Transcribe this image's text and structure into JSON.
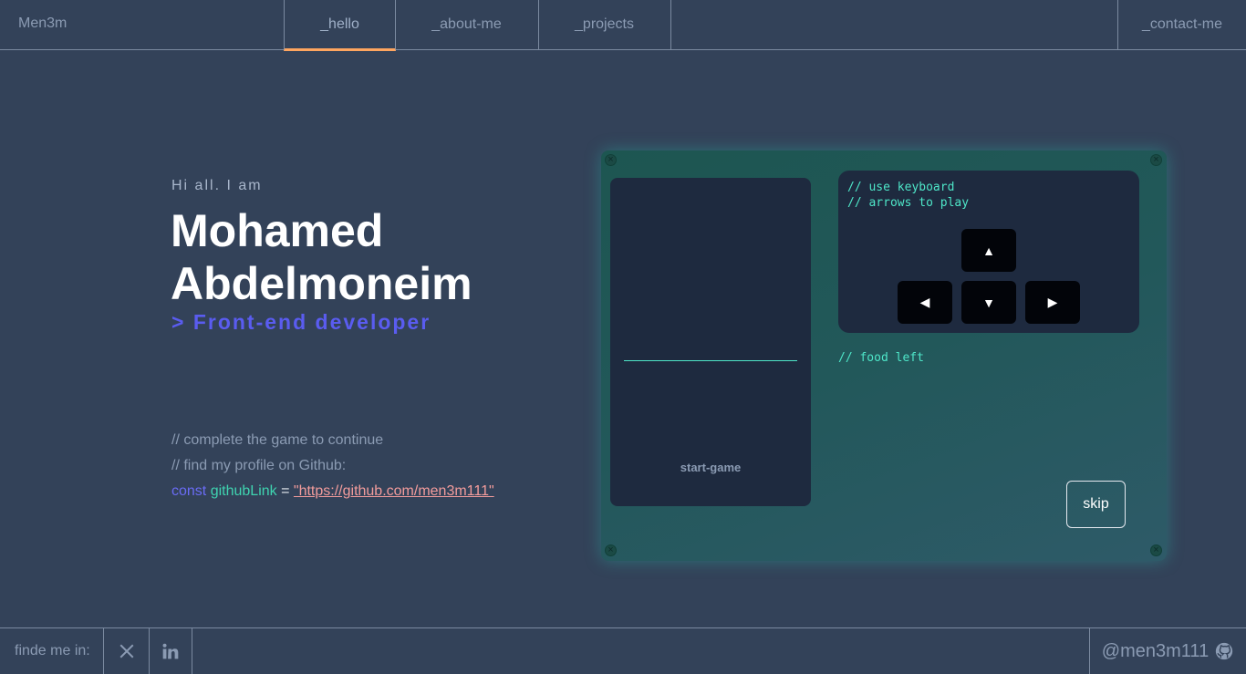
{
  "header": {
    "brand": "Men3m",
    "tabs": [
      {
        "label": "_hello",
        "active": true
      },
      {
        "label": "_about-me"
      },
      {
        "label": "_projects"
      },
      {
        "label": "_contact-me"
      }
    ],
    "accent": "#fea55f"
  },
  "hero": {
    "greeting": "Hi all. I am",
    "name_line1": "Mohamed",
    "name_line2": "Abdelmoneim",
    "role": "> Front-end developer",
    "comment1": "//   complete the game to continue",
    "comment2": "//   find my profile on Github:",
    "code_keyword": "const",
    "code_var": "githubLink",
    "code_eq": "=",
    "code_link": "\"https://github.com/men3m111\""
  },
  "game": {
    "start_label": "start-game",
    "hint_line1": "// use keyboard",
    "hint_line2": "// arrows to play",
    "food_label": "// food left",
    "skip_label": "skip",
    "keys": {
      "up": "▲",
      "left": "◀",
      "down": "▼",
      "right": "▶"
    }
  },
  "footer": {
    "find_label": "finde me in:",
    "handle": "@men3m111",
    "icons": [
      "x-icon",
      "linkedin-icon",
      "github-icon"
    ]
  },
  "colors": {
    "background": "#334259",
    "role": "#5a5cf0",
    "mint": "#4ee6c8"
  }
}
